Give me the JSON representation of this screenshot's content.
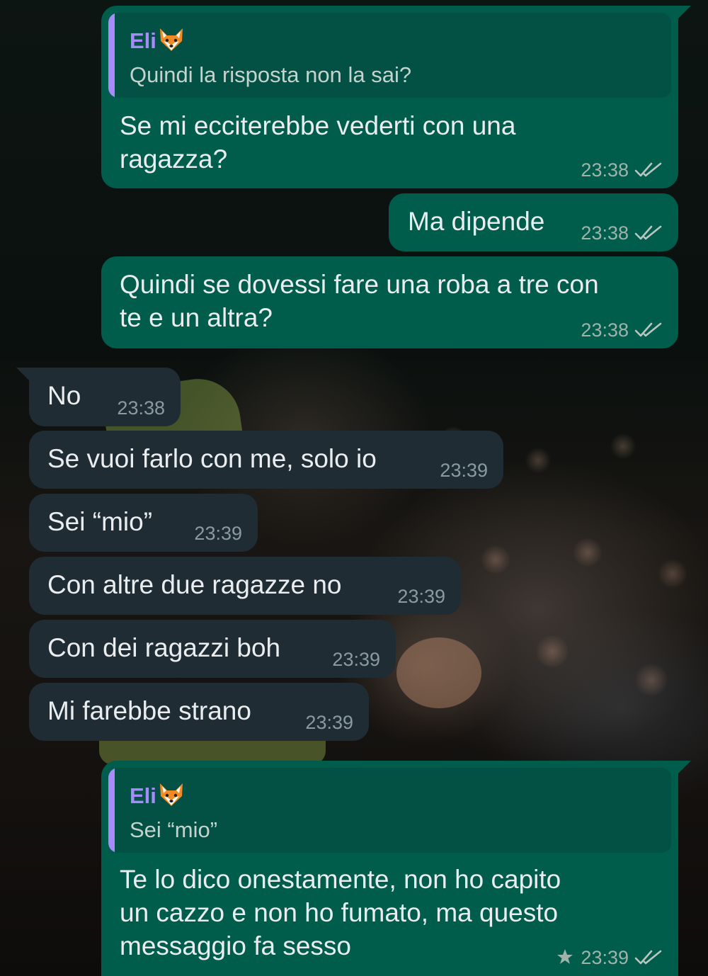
{
  "chat": {
    "reply_1": {
      "quote_sender": "Eli",
      "quote_text": "Quindi la risposta non la sai?",
      "text_line1": "Se mi ecciterebbe vederti con una",
      "text_line2": "ragazza?",
      "time": "23:38"
    },
    "out_2": {
      "text": "Ma dipende",
      "time": "23:38"
    },
    "out_3": {
      "text_line1": "Quindi se dovessi fare una roba a tre con",
      "text_line2": "te e un altra?",
      "time": "23:38"
    },
    "in_messages": [
      {
        "text": "No",
        "time": "23:38"
      },
      {
        "text": "Se vuoi farlo con me, solo io",
        "time": "23:39"
      },
      {
        "text": "Sei “mio”",
        "time": "23:39"
      },
      {
        "text": "Con altre due ragazze no",
        "time": "23:39"
      },
      {
        "text": "Con dei ragazzi boh",
        "time": "23:39"
      },
      {
        "text": "Mi farebbe strano",
        "time": "23:39"
      }
    ],
    "reply_2": {
      "quote_sender": "Eli",
      "quote_text": "Sei “mio”",
      "text_line1": "Te lo dico onestamente, non ho capito",
      "text_line2": "un cazzo e non ho fumato, ma questo",
      "text_line3": "messaggio fa sesso",
      "time": "23:39",
      "starred": true
    }
  },
  "icons": {
    "sender_emoji": "fox-face-icon",
    "read_receipt": "double-check-icon",
    "starred": "star-icon"
  },
  "colors": {
    "outgoing_bubble": "#005c4b",
    "incoming_bubble": "#202c33",
    "quote_accent": "#a78bfa",
    "text": "#e9edef"
  }
}
